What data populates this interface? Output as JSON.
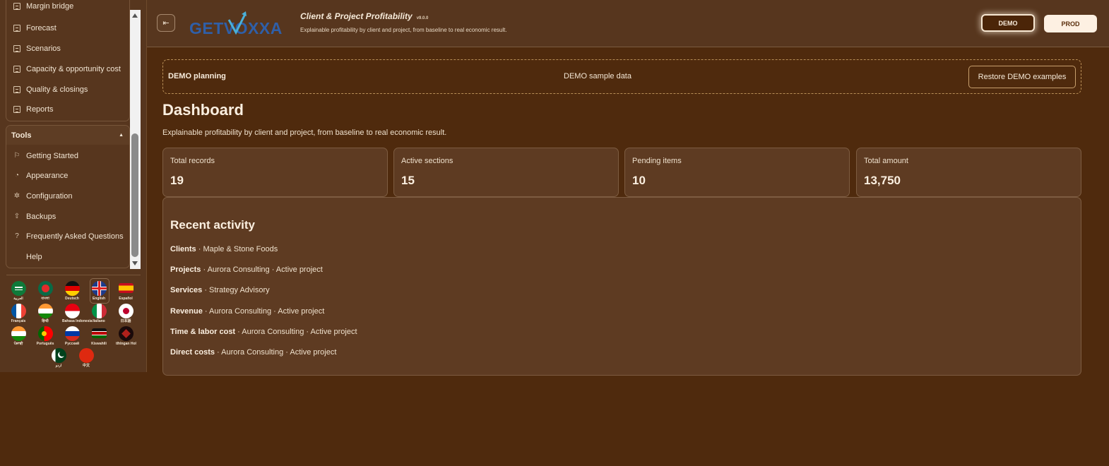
{
  "sidebar": {
    "items": [
      {
        "label": "Margin bridge",
        "icon": "document-icon"
      },
      {
        "label": "Forecast",
        "icon": "document-icon"
      },
      {
        "label": "Scenarios",
        "icon": "document-icon"
      },
      {
        "label": "Capacity & opportunity cost",
        "icon": "document-icon"
      },
      {
        "label": "Quality & closings",
        "icon": "document-icon"
      },
      {
        "label": "Reports",
        "icon": "document-icon"
      }
    ],
    "tools": {
      "title": "Tools",
      "items": [
        {
          "label": "Getting Started",
          "icon": "flag-icon"
        },
        {
          "label": "Appearance",
          "icon": "palette-icon"
        },
        {
          "label": "Configuration",
          "icon": "gear-icon"
        },
        {
          "label": "Backups",
          "icon": "upload-icon"
        },
        {
          "label": "Frequently Asked Questions",
          "icon": "help-circle-icon"
        },
        {
          "label": "Help",
          "icon": "none"
        }
      ]
    },
    "languages": [
      {
        "label": "العربية"
      },
      {
        "label": "বাংলা"
      },
      {
        "label": "Deutsch"
      },
      {
        "label": "English",
        "selected": true
      },
      {
        "label": "Español"
      },
      {
        "label": "Français"
      },
      {
        "label": "हिन्दी"
      },
      {
        "label": "Bahasa Indonesia"
      },
      {
        "label": "Italiano"
      },
      {
        "label": "日本語"
      },
      {
        "label": "ਪੰਜਾਬੀ"
      },
      {
        "label": "Português"
      },
      {
        "label": "Русский"
      },
      {
        "label": "Kiswahili"
      },
      {
        "label": "tlhIngan Hol"
      },
      {
        "label": "اردو"
      },
      {
        "label": "中文"
      }
    ]
  },
  "header": {
    "logo_text": "GETVOXXA",
    "title": "Client & Project Profitability",
    "version": "v9.0.0",
    "subtitle": "Explainable profitability by client and project, from baseline to real economic result.",
    "demo_label": "DEMO",
    "prod_label": "PROD"
  },
  "banner": {
    "title": "DEMO planning",
    "center": "DEMO sample data",
    "restore_label": "Restore DEMO examples"
  },
  "page": {
    "title": "Dashboard",
    "subtitle": "Explainable profitability by client and project, from baseline to real economic result."
  },
  "stats": [
    {
      "label": "Total records",
      "value": "19"
    },
    {
      "label": "Active sections",
      "value": "15"
    },
    {
      "label": "Pending items",
      "value": "10"
    },
    {
      "label": "Total amount",
      "value": "13,750"
    }
  ],
  "activity": {
    "title": "Recent activity",
    "rows": [
      {
        "section": "Clients",
        "detail": " · Maple & Stone Foods"
      },
      {
        "section": "Projects",
        "detail": " · Aurora Consulting · Active project"
      },
      {
        "section": "Services",
        "detail": " · Strategy Advisory"
      },
      {
        "section": "Revenue",
        "detail": " · Aurora Consulting · Active project"
      },
      {
        "section": "Time & labor cost",
        "detail": " · Aurora Consulting · Active project"
      },
      {
        "section": "Direct costs",
        "detail": " · Aurora Consulting · Active project"
      }
    ]
  }
}
